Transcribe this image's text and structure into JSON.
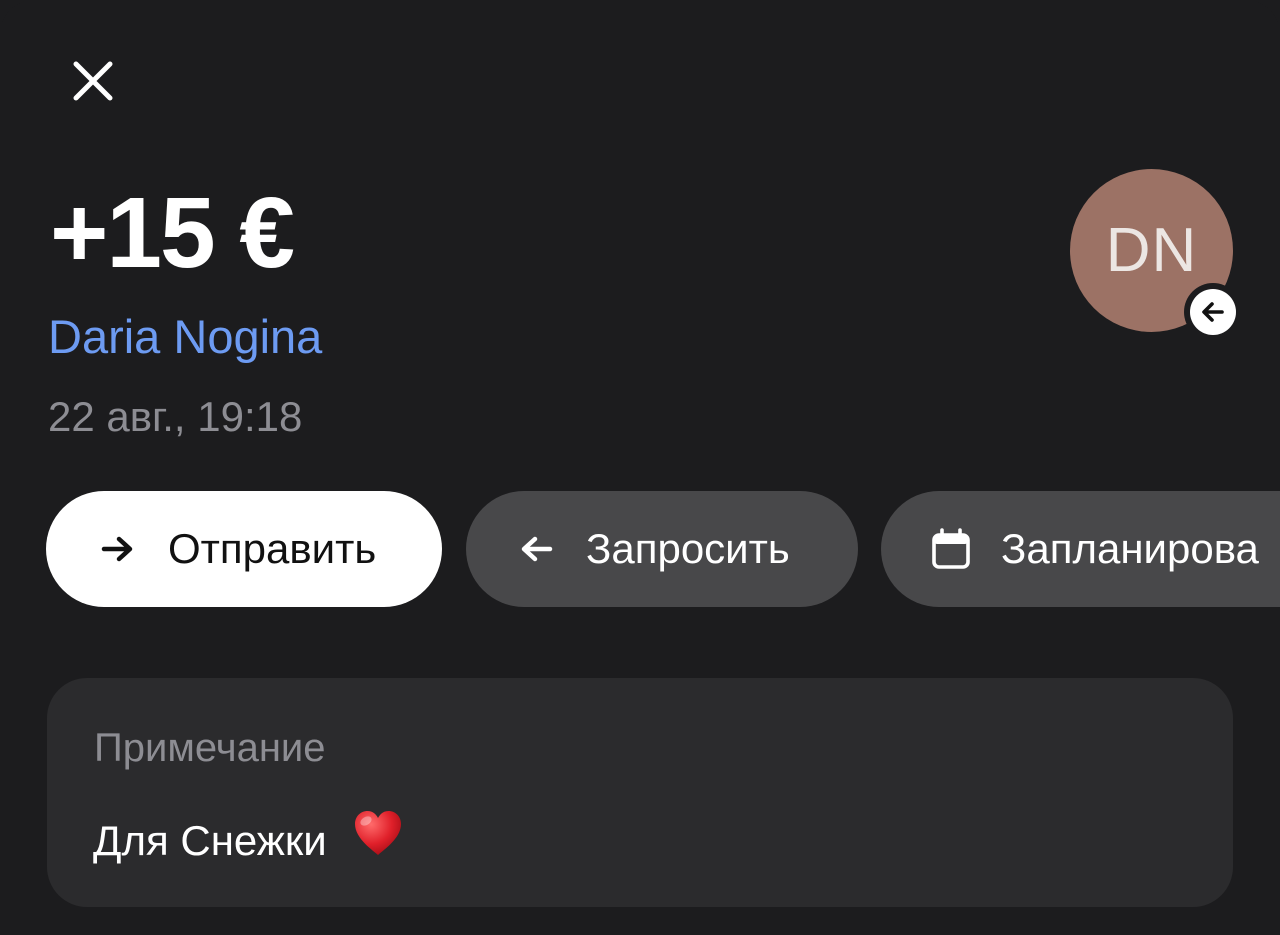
{
  "header": {
    "close_icon": "close-icon"
  },
  "transaction": {
    "amount": "+15 €",
    "counterparty_name": "Daria Nogina",
    "datetime": "22 авг., 19:18",
    "avatar_initials": "DN",
    "avatar_color": "#9c7265",
    "direction_badge_icon": "arrow-left-icon"
  },
  "actions": [
    {
      "label": "Отправить",
      "icon": "arrow-right-icon",
      "style": "primary"
    },
    {
      "label": "Запросить",
      "icon": "arrow-left-icon",
      "style": "secondary"
    },
    {
      "label": "Запланирова",
      "icon": "calendar-icon",
      "style": "secondary"
    }
  ],
  "note": {
    "title": "Примечание",
    "text": "Для Снежки",
    "emoji_icon": "red-heart-icon"
  },
  "colors": {
    "background": "#1c1c1e",
    "card": "#2b2b2d",
    "name_link": "#6d9bf2",
    "secondary_text": "#8d8d93",
    "pill_secondary": "#48484a"
  }
}
